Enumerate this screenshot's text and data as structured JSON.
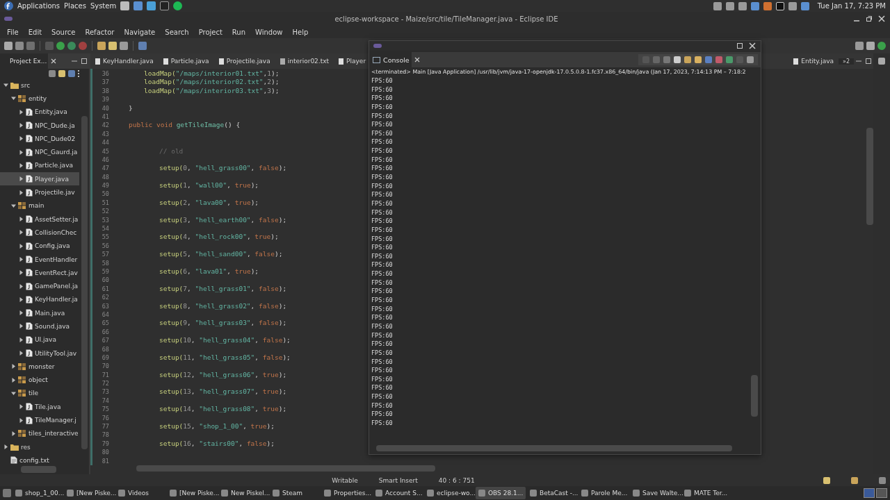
{
  "top_panel": {
    "menus": [
      "Applications",
      "Places",
      "System"
    ],
    "clock": "Tue Jan 17,  7:23 PM"
  },
  "window": {
    "title": "eclipse-workspace - Maize/src/tile/TileManager.java - Eclipse IDE"
  },
  "menu_bar": [
    "File",
    "Edit",
    "Source",
    "Refactor",
    "Navigate",
    "Search",
    "Project",
    "Run",
    "Window",
    "Help"
  ],
  "project_explorer": {
    "tab": "Project Ex...",
    "tree": [
      {
        "label": "src",
        "kind": "folder",
        "expanded": true,
        "selected": false,
        "children": [
          {
            "label": "entity",
            "kind": "package",
            "expanded": true,
            "selected": false,
            "children": [
              {
                "label": "Entity.java",
                "kind": "file",
                "expanded": false,
                "selected": false
              },
              {
                "label": "NPC_Dude.ja",
                "kind": "file",
                "expanded": false,
                "selected": false
              },
              {
                "label": "NPC_Dude02",
                "kind": "file",
                "expanded": false,
                "selected": false
              },
              {
                "label": "NPC_Gaurd.ja",
                "kind": "file",
                "expanded": false,
                "selected": false
              },
              {
                "label": "Particle.java",
                "kind": "file",
                "expanded": false,
                "selected": false
              },
              {
                "label": "Player.java",
                "kind": "file",
                "expanded": false,
                "selected": true
              },
              {
                "label": "Projectile.jav",
                "kind": "file",
                "expanded": false,
                "selected": false
              }
            ]
          },
          {
            "label": "main",
            "kind": "package",
            "expanded": true,
            "selected": false,
            "children": [
              {
                "label": "AssetSetter.ja",
                "kind": "file",
                "expanded": false,
                "selected": false
              },
              {
                "label": "CollisionChec",
                "kind": "file",
                "expanded": false,
                "selected": false
              },
              {
                "label": "Config.java",
                "kind": "file",
                "expanded": false,
                "selected": false
              },
              {
                "label": "EventHandler",
                "kind": "file",
                "expanded": false,
                "selected": false
              },
              {
                "label": "EventRect.jav",
                "kind": "file",
                "expanded": false,
                "selected": false
              },
              {
                "label": "GamePanel.ja",
                "kind": "file",
                "expanded": false,
                "selected": false
              },
              {
                "label": "KeyHandler.ja",
                "kind": "file",
                "expanded": false,
                "selected": false
              },
              {
                "label": "Main.java",
                "kind": "file",
                "expanded": false,
                "selected": false
              },
              {
                "label": "Sound.java",
                "kind": "file",
                "expanded": false,
                "selected": false
              },
              {
                "label": "UI.java",
                "kind": "file",
                "expanded": false,
                "selected": false
              },
              {
                "label": "UtilityTool.jav",
                "kind": "file",
                "expanded": false,
                "selected": false
              }
            ]
          },
          {
            "label": "monster",
            "kind": "package",
            "expanded": false,
            "selected": false
          },
          {
            "label": "object",
            "kind": "package",
            "expanded": false,
            "selected": false
          },
          {
            "label": "tile",
            "kind": "package",
            "expanded": true,
            "selected": false,
            "children": [
              {
                "label": "Tile.java",
                "kind": "file",
                "expanded": false,
                "selected": false
              },
              {
                "label": "TileManager.j",
                "kind": "file",
                "expanded": false,
                "selected": false
              }
            ]
          },
          {
            "label": "tiles_interactive",
            "kind": "package",
            "expanded": false,
            "selected": false
          }
        ]
      },
      {
        "label": "res",
        "kind": "folder",
        "expanded": false,
        "selected": false
      },
      {
        "label": "config.txt",
        "kind": "text",
        "selected": false
      }
    ]
  },
  "editor": {
    "tabs": [
      {
        "label": "KeyHandler.java",
        "kind": "java",
        "selected": false
      },
      {
        "label": "Particle.java",
        "kind": "java",
        "selected": false
      },
      {
        "label": "Projectile.java",
        "kind": "java",
        "selected": false
      },
      {
        "label": "interior02.txt",
        "kind": "text",
        "selected": false
      },
      {
        "label": "Player",
        "kind": "java",
        "selected": false
      }
    ],
    "right_tabs": [
      {
        "label": "Entity.java",
        "kind": "java",
        "selected": false
      }
    ],
    "overflow": "»2",
    "lines": [
      {
        "number": "36",
        "kind": "stmt",
        "segments": [
          {
            "kind": "call",
            "text": "loadMap("
          },
          {
            "kind": "string",
            "text": "\"/maps/interior01.txt\""
          },
          {
            "kind": "plain",
            "text": ","
          },
          {
            "kind": "number",
            "text": "1"
          },
          {
            "kind": "plain",
            "text": ");"
          }
        ]
      },
      {
        "number": "37",
        "kind": "stmt",
        "segments": [
          {
            "kind": "call",
            "text": "loadMap("
          },
          {
            "kind": "string",
            "text": "\"/maps/interior02.txt\""
          },
          {
            "kind": "plain",
            "text": ","
          },
          {
            "kind": "number",
            "text": "2"
          },
          {
            "kind": "plain",
            "text": ");"
          }
        ]
      },
      {
        "number": "38",
        "kind": "stmt",
        "segments": [
          {
            "kind": "call",
            "text": "loadMap("
          },
          {
            "kind": "string",
            "text": "\"/maps/interior03.txt\""
          },
          {
            "kind": "plain",
            "text": ","
          },
          {
            "kind": "number",
            "text": "3"
          },
          {
            "kind": "plain",
            "text": ");"
          }
        ]
      },
      {
        "number": "39"
      },
      {
        "number": "40",
        "kind": "decl",
        "segments": [
          {
            "kind": "plain",
            "text": "}"
          }
        ]
      },
      {
        "number": "41"
      },
      {
        "number": "42",
        "kind": "decl",
        "segments": [
          {
            "kind": "keyword",
            "text": "public void"
          },
          {
            "kind": "method",
            "text": " getTileImage"
          },
          {
            "kind": "plain",
            "text": "() {"
          }
        ]
      },
      {
        "number": "43"
      },
      {
        "number": "44"
      },
      {
        "number": "45",
        "kind": "inner",
        "segments": [
          {
            "kind": "comment",
            "text": "// old"
          }
        ]
      },
      {
        "number": "46"
      },
      {
        "number": "47",
        "kind": "inner",
        "segments": [
          {
            "kind": "call",
            "text": "setup("
          },
          {
            "kind": "number",
            "text": "0"
          },
          {
            "kind": "plain",
            "text": ", "
          },
          {
            "kind": "string",
            "text": "\"hell_grass00\""
          },
          {
            "kind": "plain",
            "text": ", "
          },
          {
            "kind": "keyword",
            "text": "false"
          },
          {
            "kind": "plain",
            "text": ");"
          }
        ]
      },
      {
        "number": "48"
      },
      {
        "number": "49",
        "kind": "inner",
        "segments": [
          {
            "kind": "call",
            "text": "setup("
          },
          {
            "kind": "number",
            "text": "1"
          },
          {
            "kind": "plain",
            "text": ", "
          },
          {
            "kind": "string",
            "text": "\"wall00\""
          },
          {
            "kind": "plain",
            "text": ", "
          },
          {
            "kind": "keyword",
            "text": "true"
          },
          {
            "kind": "plain",
            "text": ");"
          }
        ]
      },
      {
        "number": "50"
      },
      {
        "number": "51",
        "kind": "inner",
        "segments": [
          {
            "kind": "call",
            "text": "setup("
          },
          {
            "kind": "number",
            "text": "2"
          },
          {
            "kind": "plain",
            "text": ", "
          },
          {
            "kind": "string",
            "text": "\"lava00\""
          },
          {
            "kind": "plain",
            "text": ", "
          },
          {
            "kind": "keyword",
            "text": "true"
          },
          {
            "kind": "plain",
            "text": ");"
          }
        ]
      },
      {
        "number": "52"
      },
      {
        "number": "53",
        "kind": "inner",
        "segments": [
          {
            "kind": "call",
            "text": "setup("
          },
          {
            "kind": "number",
            "text": "3"
          },
          {
            "kind": "plain",
            "text": ", "
          },
          {
            "kind": "string",
            "text": "\"hell_earth00\""
          },
          {
            "kind": "plain",
            "text": ", "
          },
          {
            "kind": "keyword",
            "text": "false"
          },
          {
            "kind": "plain",
            "text": ");"
          }
        ]
      },
      {
        "number": "54"
      },
      {
        "number": "55",
        "kind": "inner",
        "segments": [
          {
            "kind": "call",
            "text": "setup("
          },
          {
            "kind": "number",
            "text": "4"
          },
          {
            "kind": "plain",
            "text": ", "
          },
          {
            "kind": "string",
            "text": "\"hell_rock00\""
          },
          {
            "kind": "plain",
            "text": ", "
          },
          {
            "kind": "keyword",
            "text": "true"
          },
          {
            "kind": "plain",
            "text": ");"
          }
        ]
      },
      {
        "number": "56"
      },
      {
        "number": "57",
        "kind": "inner",
        "segments": [
          {
            "kind": "call",
            "text": "setup("
          },
          {
            "kind": "number",
            "text": "5"
          },
          {
            "kind": "plain",
            "text": ", "
          },
          {
            "kind": "string",
            "text": "\"hell_sand00\""
          },
          {
            "kind": "plain",
            "text": ", "
          },
          {
            "kind": "keyword",
            "text": "false"
          },
          {
            "kind": "plain",
            "text": ");"
          }
        ]
      },
      {
        "number": "58"
      },
      {
        "number": "59",
        "kind": "inner",
        "segments": [
          {
            "kind": "call",
            "text": "setup("
          },
          {
            "kind": "number",
            "text": "6"
          },
          {
            "kind": "plain",
            "text": ", "
          },
          {
            "kind": "string",
            "text": "\"lava01\""
          },
          {
            "kind": "plain",
            "text": ", "
          },
          {
            "kind": "keyword",
            "text": "true"
          },
          {
            "kind": "plain",
            "text": ");"
          }
        ]
      },
      {
        "number": "60"
      },
      {
        "number": "61",
        "kind": "inner",
        "segments": [
          {
            "kind": "call",
            "text": "setup("
          },
          {
            "kind": "number",
            "text": "7"
          },
          {
            "kind": "plain",
            "text": ", "
          },
          {
            "kind": "string",
            "text": "\"hell_grass01\""
          },
          {
            "kind": "plain",
            "text": ", "
          },
          {
            "kind": "keyword",
            "text": "false"
          },
          {
            "kind": "plain",
            "text": ");"
          }
        ]
      },
      {
        "number": "62"
      },
      {
        "number": "63",
        "kind": "inner",
        "segments": [
          {
            "kind": "call",
            "text": "setup("
          },
          {
            "kind": "number",
            "text": "8"
          },
          {
            "kind": "plain",
            "text": ", "
          },
          {
            "kind": "string",
            "text": "\"hell_grass02\""
          },
          {
            "kind": "plain",
            "text": ", "
          },
          {
            "kind": "keyword",
            "text": "false"
          },
          {
            "kind": "plain",
            "text": ");"
          }
        ]
      },
      {
        "number": "64"
      },
      {
        "number": "65",
        "kind": "inner",
        "segments": [
          {
            "kind": "call",
            "text": "setup("
          },
          {
            "kind": "number",
            "text": "9"
          },
          {
            "kind": "plain",
            "text": ", "
          },
          {
            "kind": "string",
            "text": "\"hell_grass03\""
          },
          {
            "kind": "plain",
            "text": ", "
          },
          {
            "kind": "keyword",
            "text": "false"
          },
          {
            "kind": "plain",
            "text": ");"
          }
        ]
      },
      {
        "number": "66"
      },
      {
        "number": "67",
        "kind": "inner",
        "segments": [
          {
            "kind": "call",
            "text": "setup("
          },
          {
            "kind": "number",
            "text": "10"
          },
          {
            "kind": "plain",
            "text": ", "
          },
          {
            "kind": "string",
            "text": "\"hell_grass04\""
          },
          {
            "kind": "plain",
            "text": ", "
          },
          {
            "kind": "keyword",
            "text": "false"
          },
          {
            "kind": "plain",
            "text": ");"
          }
        ]
      },
      {
        "number": "68"
      },
      {
        "number": "69",
        "kind": "inner",
        "segments": [
          {
            "kind": "call",
            "text": "setup("
          },
          {
            "kind": "number",
            "text": "11"
          },
          {
            "kind": "plain",
            "text": ", "
          },
          {
            "kind": "string",
            "text": "\"hell_grass05\""
          },
          {
            "kind": "plain",
            "text": ", "
          },
          {
            "kind": "keyword",
            "text": "false"
          },
          {
            "kind": "plain",
            "text": ");"
          }
        ]
      },
      {
        "number": "70"
      },
      {
        "number": "71",
        "kind": "inner",
        "segments": [
          {
            "kind": "call",
            "text": "setup("
          },
          {
            "kind": "number",
            "text": "12"
          },
          {
            "kind": "plain",
            "text": ", "
          },
          {
            "kind": "string",
            "text": "\"hell_grass06\""
          },
          {
            "kind": "plain",
            "text": ", "
          },
          {
            "kind": "keyword",
            "text": "true"
          },
          {
            "kind": "plain",
            "text": ");"
          }
        ]
      },
      {
        "number": "72"
      },
      {
        "number": "73",
        "kind": "inner",
        "segments": [
          {
            "kind": "call",
            "text": "setup("
          },
          {
            "kind": "number",
            "text": "13"
          },
          {
            "kind": "plain",
            "text": ", "
          },
          {
            "kind": "string",
            "text": "\"hell_grass07\""
          },
          {
            "kind": "plain",
            "text": ", "
          },
          {
            "kind": "keyword",
            "text": "true"
          },
          {
            "kind": "plain",
            "text": ");"
          }
        ]
      },
      {
        "number": "74"
      },
      {
        "number": "75",
        "kind": "inner",
        "segments": [
          {
            "kind": "call",
            "text": "setup("
          },
          {
            "kind": "number",
            "text": "14"
          },
          {
            "kind": "plain",
            "text": ", "
          },
          {
            "kind": "string",
            "text": "\"hell_grass08\""
          },
          {
            "kind": "plain",
            "text": ", "
          },
          {
            "kind": "keyword",
            "text": "true"
          },
          {
            "kind": "plain",
            "text": ");"
          }
        ]
      },
      {
        "number": "76"
      },
      {
        "number": "77",
        "kind": "inner",
        "segments": [
          {
            "kind": "call",
            "text": "setup("
          },
          {
            "kind": "number",
            "text": "15"
          },
          {
            "kind": "plain",
            "text": ", "
          },
          {
            "kind": "string",
            "text": "\"shop_1_00\""
          },
          {
            "kind": "plain",
            "text": ", "
          },
          {
            "kind": "keyword",
            "text": "true"
          },
          {
            "kind": "plain",
            "text": ");"
          }
        ]
      },
      {
        "number": "78"
      },
      {
        "number": "79",
        "kind": "inner",
        "segments": [
          {
            "kind": "call",
            "text": "setup("
          },
          {
            "kind": "number",
            "text": "16"
          },
          {
            "kind": "plain",
            "text": ", "
          },
          {
            "kind": "string",
            "text": "\"stairs00\""
          },
          {
            "kind": "plain",
            "text": ", "
          },
          {
            "kind": "keyword",
            "text": "false"
          },
          {
            "kind": "plain",
            "text": ");"
          }
        ]
      },
      {
        "number": "80"
      },
      {
        "number": "81"
      }
    ]
  },
  "console": {
    "tab": "Console",
    "header": "<terminated> Main [Java Application] /usr/lib/jvm/java-17-openjdk-17.0.5.0.8-1.fc37.x86_64/bin/java  (Jan 17, 2023, 7:14:13 PM – 7:18:2",
    "output": [
      "FPS:60",
      "FPS:60",
      "FPS:60",
      "FPS:60",
      "FPS:60",
      "FPS:60",
      "FPS:60",
      "FPS:60",
      "FPS:60",
      "FPS:60",
      "FPS:60",
      "FPS:60",
      "FPS:60",
      "FPS:60",
      "FPS:60",
      "FPS:60",
      "FPS:60",
      "FPS:60",
      "FPS:60",
      "FPS:60",
      "FPS:60",
      "FPS:60",
      "FPS:60",
      "FPS:60",
      "FPS:60",
      "FPS:60",
      "FPS:60",
      "FPS:60",
      "FPS:60",
      "FPS:60",
      "FPS:60",
      "FPS:60",
      "FPS:60",
      "FPS:60",
      "FPS:60",
      "FPS:60",
      "FPS:60",
      "FPS:60",
      "FPS:60",
      "FPS:60"
    ]
  },
  "status_bar": {
    "mode": "Writable",
    "insert": "Smart Insert",
    "position": "40 : 6 : 751"
  },
  "taskbar": [
    {
      "label": "shop_1_00...",
      "selected": false
    },
    {
      "label": "[New Piske...",
      "selected": false
    },
    {
      "label": "Videos",
      "selected": false
    },
    {
      "label": "[New Piske...",
      "selected": false
    },
    {
      "label": "New Piskel...",
      "selected": false
    },
    {
      "label": "Steam",
      "selected": false
    },
    {
      "label": "Properties...",
      "selected": false
    },
    {
      "label": "Account S...",
      "selected": false
    },
    {
      "label": "eclipse-wo...",
      "selected": false
    },
    {
      "label": "OBS 28.1...",
      "selected": true
    },
    {
      "label": "BetaCast -...",
      "selected": false
    },
    {
      "label": "Parole Me...",
      "selected": false
    },
    {
      "label": "Save Walte...",
      "selected": false
    },
    {
      "label": "MATE Ter...",
      "selected": false
    }
  ]
}
